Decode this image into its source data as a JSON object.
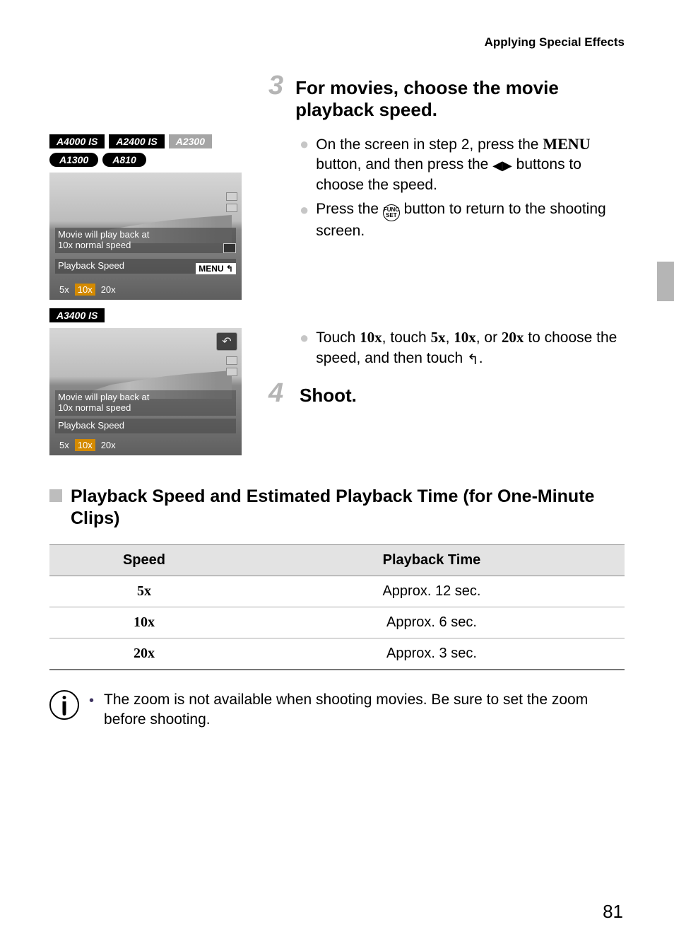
{
  "header": {
    "section_title": "Applying Special Effects"
  },
  "models": {
    "group1": [
      "A4000 IS",
      "A2400 IS",
      "A2300",
      "A1300",
      "A810"
    ],
    "group2": [
      "A3400 IS"
    ]
  },
  "screenshot1": {
    "msg_line1": "Movie will play back at",
    "msg_line2": "10x normal speed",
    "label": "Playback Speed",
    "menu_back": "MENU ↰",
    "speeds": [
      "5x",
      "10x",
      "20x"
    ],
    "selected": "10x"
  },
  "screenshot2": {
    "msg_line1": "Movie will play back at",
    "msg_line2": "10x normal speed",
    "label": "Playback Speed",
    "speeds": [
      "5x",
      "10x",
      "20x"
    ],
    "selected": "10x"
  },
  "steps": {
    "s3": {
      "num": "3",
      "title": "For movies, choose the movie playback speed.",
      "b1_a": "On the screen in step 2, press the ",
      "b1_menu": "MENU",
      "b1_b": " button, and then press the ",
      "b1_c": " buttons to choose the speed.",
      "b2_a": "Press the ",
      "b2_func_top": "FUNC",
      "b2_func_bot": "SET",
      "b2_b": " button to return to the shooting screen.",
      "b3_a": "Touch ",
      "b3_b": ", touch ",
      "b3_c": ", ",
      "b3_d": ", or ",
      "b3_e": " to choose the speed, and then touch ",
      "b3_f": ".",
      "x10": "10x",
      "x5": "5x",
      "x20": "20x"
    },
    "s4": {
      "num": "4",
      "title": "Shoot."
    }
  },
  "subsection": {
    "title": "Playback Speed and Estimated Playback Time (for One-Minute Clips)"
  },
  "chart_data": {
    "type": "table",
    "title": "Playback Speed and Estimated Playback Time (for One-Minute Clips)",
    "columns": [
      "Speed",
      "Playback Time"
    ],
    "rows": [
      {
        "speed": "5x",
        "time": "Approx. 12 sec."
      },
      {
        "speed": "10x",
        "time": "Approx. 6 sec."
      },
      {
        "speed": "20x",
        "time": "Approx. 3 sec."
      }
    ]
  },
  "note": {
    "text": "The zoom is not available when shooting movies. Be sure to set the zoom before shooting."
  },
  "page": {
    "number": "81"
  }
}
